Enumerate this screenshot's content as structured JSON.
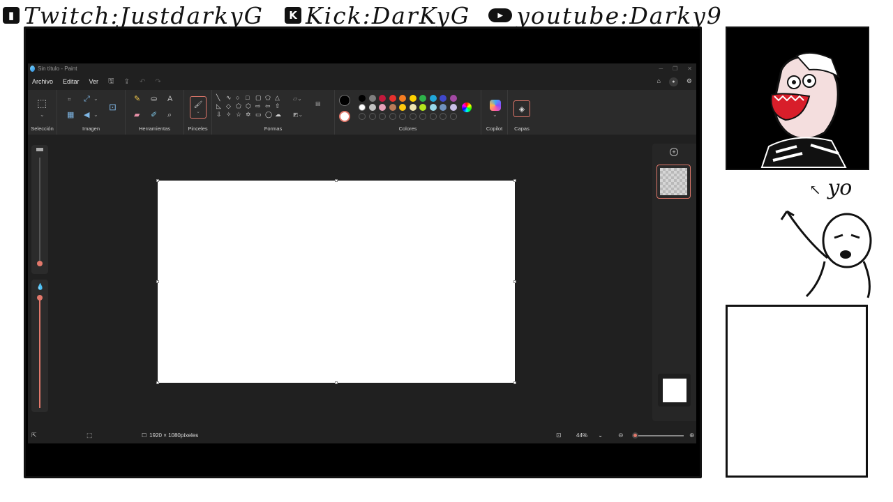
{
  "banner": {
    "twitch": "Twitch:JustdarkyG",
    "kick": "Kick:DarKyG",
    "youtube": "youtube:Darky9",
    "kick_glyph": "K",
    "youtube_glyph": "▶"
  },
  "paint": {
    "window_title": "Sin título - Paint",
    "menu": {
      "archivo": "Archivo",
      "editar": "Editar",
      "ver": "Ver"
    },
    "groups": {
      "seleccion": "Selección",
      "imagen": "Imagen",
      "herramientas": "Herramientas",
      "pinceles": "Pinceles",
      "formas": "Formas",
      "colores": "Colores",
      "copilot": "Copilot",
      "capas": "Capas"
    },
    "palette": {
      "row1": [
        "#000000",
        "#7f7f7f",
        "#c3193c",
        "#e8312d",
        "#f57d22",
        "#ffd200",
        "#2eb34a",
        "#20a7d9",
        "#3f48cc",
        "#a349a4"
      ],
      "row2": [
        "#ffffff",
        "#c3c3c3",
        "#e6a1b9",
        "#b97a57",
        "#ffc90e",
        "#efe4b0",
        "#b5e61d",
        "#99d9ea",
        "#7092be",
        "#c8bfe7"
      ]
    },
    "status": {
      "dimensions": "1920 × 1080píxeles",
      "zoom": "44%"
    }
  },
  "overlay": {
    "yo_text": "yo"
  }
}
